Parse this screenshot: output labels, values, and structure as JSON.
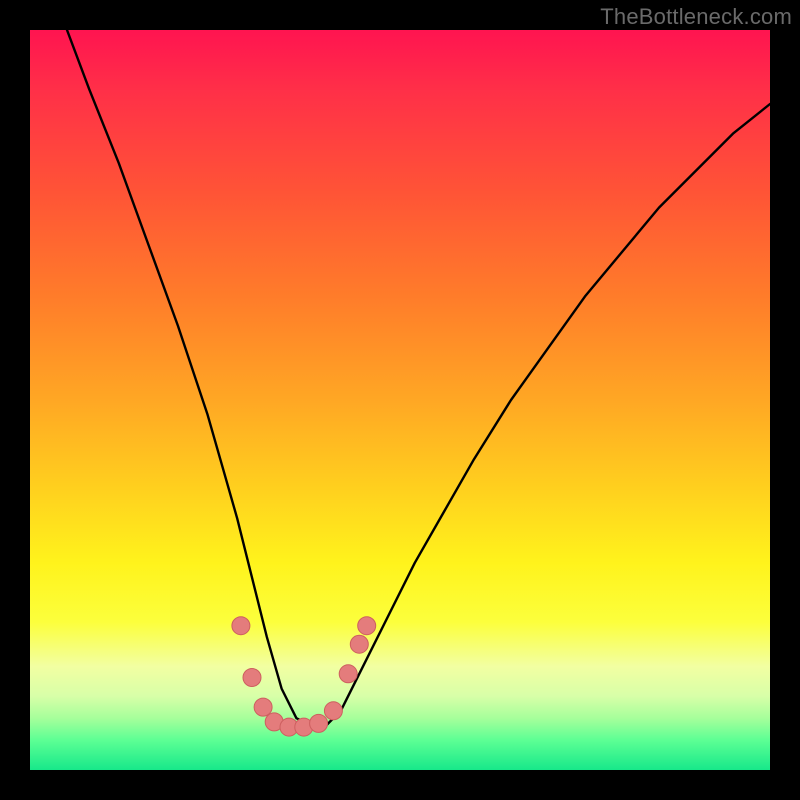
{
  "attribution": "TheBottleneck.com",
  "colors": {
    "frame": "#000000",
    "curve_stroke": "#000000",
    "marker_fill": "#e47c7c",
    "marker_stroke": "#cd5f5f",
    "gradient_stops": [
      "#ff1450",
      "#ff2f48",
      "#ff5436",
      "#ff7c2a",
      "#ffa724",
      "#ffd01e",
      "#fff31c",
      "#fcff3c",
      "#f2ffa2",
      "#d8ffa8",
      "#a6ff9b",
      "#5cff94",
      "#17e88a"
    ]
  },
  "chart_data": {
    "type": "line",
    "title": "",
    "xlabel": "",
    "ylabel": "",
    "x_range": [
      0,
      100
    ],
    "y_range": [
      0,
      100
    ],
    "note": "Axes have no visible tick labels; x/y values are positional percentages read from the plot area. The curve shows a bottleneck-style V with minimum near x≈35.",
    "series": [
      {
        "name": "bottleneck-curve",
        "x": [
          5,
          8,
          12,
          16,
          20,
          24,
          26,
          28,
          30,
          32,
          34,
          36,
          38,
          40,
          42,
          44,
          48,
          52,
          56,
          60,
          65,
          70,
          75,
          80,
          85,
          90,
          95,
          100
        ],
        "y": [
          100,
          92,
          82,
          71,
          60,
          48,
          41,
          34,
          26,
          18,
          11,
          7,
          6,
          6,
          8,
          12,
          20,
          28,
          35,
          42,
          50,
          57,
          64,
          70,
          76,
          81,
          86,
          90
        ]
      }
    ],
    "markers": {
      "name": "highlight-dots",
      "note": "Salmon-colored dots near the valley of the curve.",
      "points": [
        {
          "x": 28.5,
          "y": 19.5
        },
        {
          "x": 30.0,
          "y": 12.5
        },
        {
          "x": 31.5,
          "y": 8.5
        },
        {
          "x": 33.0,
          "y": 6.5
        },
        {
          "x": 35.0,
          "y": 5.8
        },
        {
          "x": 37.0,
          "y": 5.8
        },
        {
          "x": 39.0,
          "y": 6.3
        },
        {
          "x": 41.0,
          "y": 8.0
        },
        {
          "x": 43.0,
          "y": 13.0
        },
        {
          "x": 44.5,
          "y": 17.0
        },
        {
          "x": 45.5,
          "y": 19.5
        }
      ]
    }
  }
}
